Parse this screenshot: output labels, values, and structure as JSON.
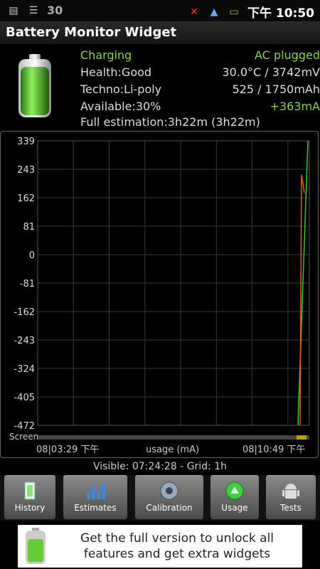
{
  "status": {
    "notif_number": "30",
    "time": "下午 10:50"
  },
  "app": {
    "title": "Battery Monitor Widget"
  },
  "info": {
    "status_label": "Charging",
    "plugged": "AC plugged",
    "health": "Health:Good",
    "temp_voltage": "30.0°C / 3742mV",
    "techno": "Techno:Li-poly",
    "capacity": "525 / 1750mAh",
    "available": "Available:30%",
    "current": "+363mA",
    "estimation": "Full estimation:3h22m (3h22m)"
  },
  "graph": {
    "screen_label": "Screen",
    "x_start": "08|03:29 下午",
    "x_title": "usage (mA)",
    "x_end": "08|10:49 下午"
  },
  "visible_text": "Visible: 07:24:28 - Grid: 1h",
  "buttons": [
    {
      "label": "History"
    },
    {
      "label": "Estimates"
    },
    {
      "label": "Calibration"
    },
    {
      "label": "Usage"
    },
    {
      "label": "Tests"
    }
  ],
  "ad": {
    "text": "Get the full version to unlock all features and get extra widgets"
  },
  "colors": {
    "accent_green": "#8fd14f",
    "line_green": "#33cc33",
    "line_orange": "#e06020"
  },
  "chart_data": {
    "type": "line",
    "y_ticks": [
      "339",
      "243",
      "162",
      "81",
      "0",
      "-81",
      "-162",
      "-243",
      "-324",
      "-405",
      "-472"
    ],
    "ylim": [
      -472,
      339
    ],
    "series": [
      {
        "values": [
          -472,
          339
        ]
      },
      {
        "values": [
          -472,
          243,
          190
        ]
      }
    ],
    "grid": true
  }
}
